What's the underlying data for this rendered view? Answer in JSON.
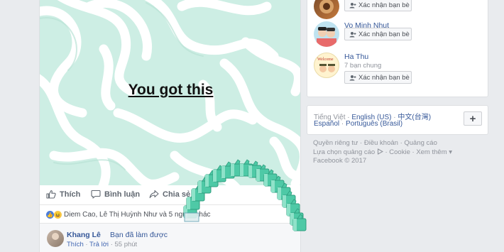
{
  "post": {
    "caption": "You got this",
    "actions": {
      "like": "Thích",
      "comment": "Bình luận",
      "share": "Chia sẻ"
    },
    "reactions_text": "Diem Cao, Lê Thị Huỳnh Như và 5 người khác",
    "comment": {
      "author": "Khang Lê",
      "text": "Bạn đã làm được",
      "like_link": "Thích",
      "reply_link": "Trả lời",
      "time": "55 phút"
    }
  },
  "suggestions": {
    "button_label": "Xác nhận bạn bè",
    "people": [
      {
        "name": "",
        "subtitle": ""
      },
      {
        "name": "Vo Minh Nhut",
        "subtitle": ""
      },
      {
        "name": "Ha Thu",
        "subtitle": "7 bạn chung"
      }
    ]
  },
  "languages": {
    "current": "Tiếng Việt",
    "line1": [
      "English (US)",
      "中文(台灣)"
    ],
    "line2": [
      "Español",
      "Português (Brasil)"
    ],
    "plus_label": "+"
  },
  "footer": {
    "line1": [
      "Quyền riêng tư",
      "Điều khoản",
      "Quảng cáo"
    ],
    "line2_link": "Lựa chọn quảng cáo",
    "line2_rest": [
      "Cookie",
      "Xem thêm"
    ],
    "copyright": "Facebook © 2017"
  },
  "colors": {
    "link": "#365899",
    "pattern_bg": "#cdeee4",
    "pattern_stroke": "#ffffff",
    "like_green": "#3fbf9b"
  }
}
